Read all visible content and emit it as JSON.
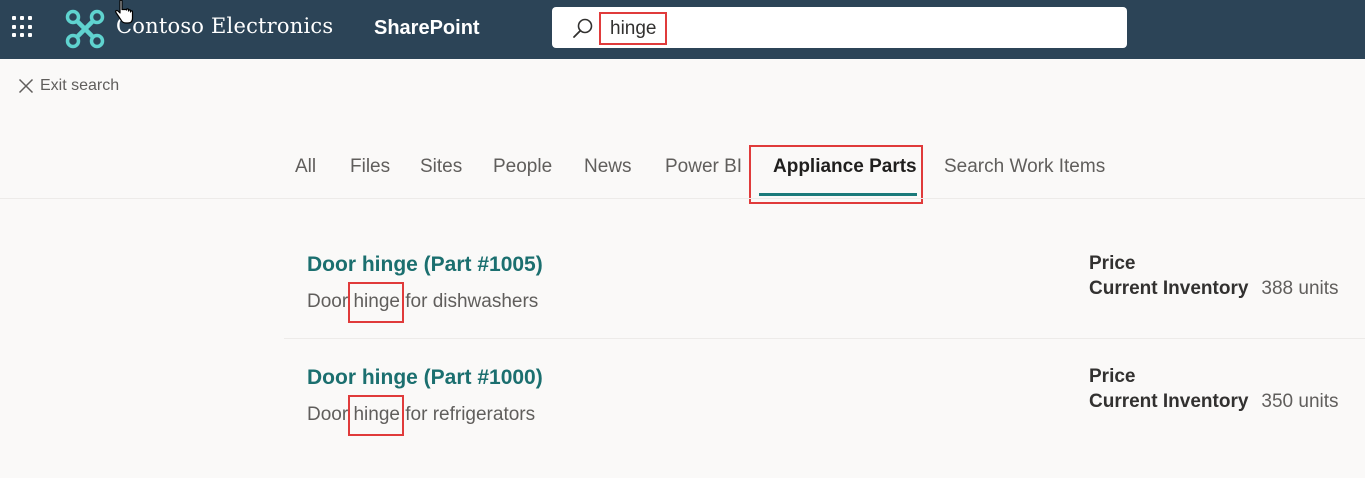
{
  "header": {
    "brand": "Contoso Electronics",
    "app_name": "SharePoint",
    "search_value": "hinge",
    "colors": {
      "bar": "#2c4457",
      "accent": "#1b7a7a",
      "highlight": "#e03b3b"
    }
  },
  "exit_search": {
    "label": "Exit search",
    "icon": "close-icon"
  },
  "tabs": [
    {
      "label": "All"
    },
    {
      "label": "Files"
    },
    {
      "label": "Sites"
    },
    {
      "label": "People"
    },
    {
      "label": "News"
    },
    {
      "label": "Power BI"
    },
    {
      "label": "Appliance Parts",
      "active": true
    },
    {
      "label": "Search Work Items"
    }
  ],
  "results": [
    {
      "title": "Door hinge (Part #1005)",
      "desc_before": "Door ",
      "desc_match": "hinge",
      "desc_after": " for dishwashers",
      "price_label": "Price",
      "inventory_label": "Current Inventory",
      "inventory_value": "388 units"
    },
    {
      "title": "Door hinge (Part #1000)",
      "desc_before": "Door ",
      "desc_match": "hinge",
      "desc_after": " for refrigerators",
      "price_label": "Price",
      "inventory_label": "Current Inventory",
      "inventory_value": "350 units"
    }
  ]
}
